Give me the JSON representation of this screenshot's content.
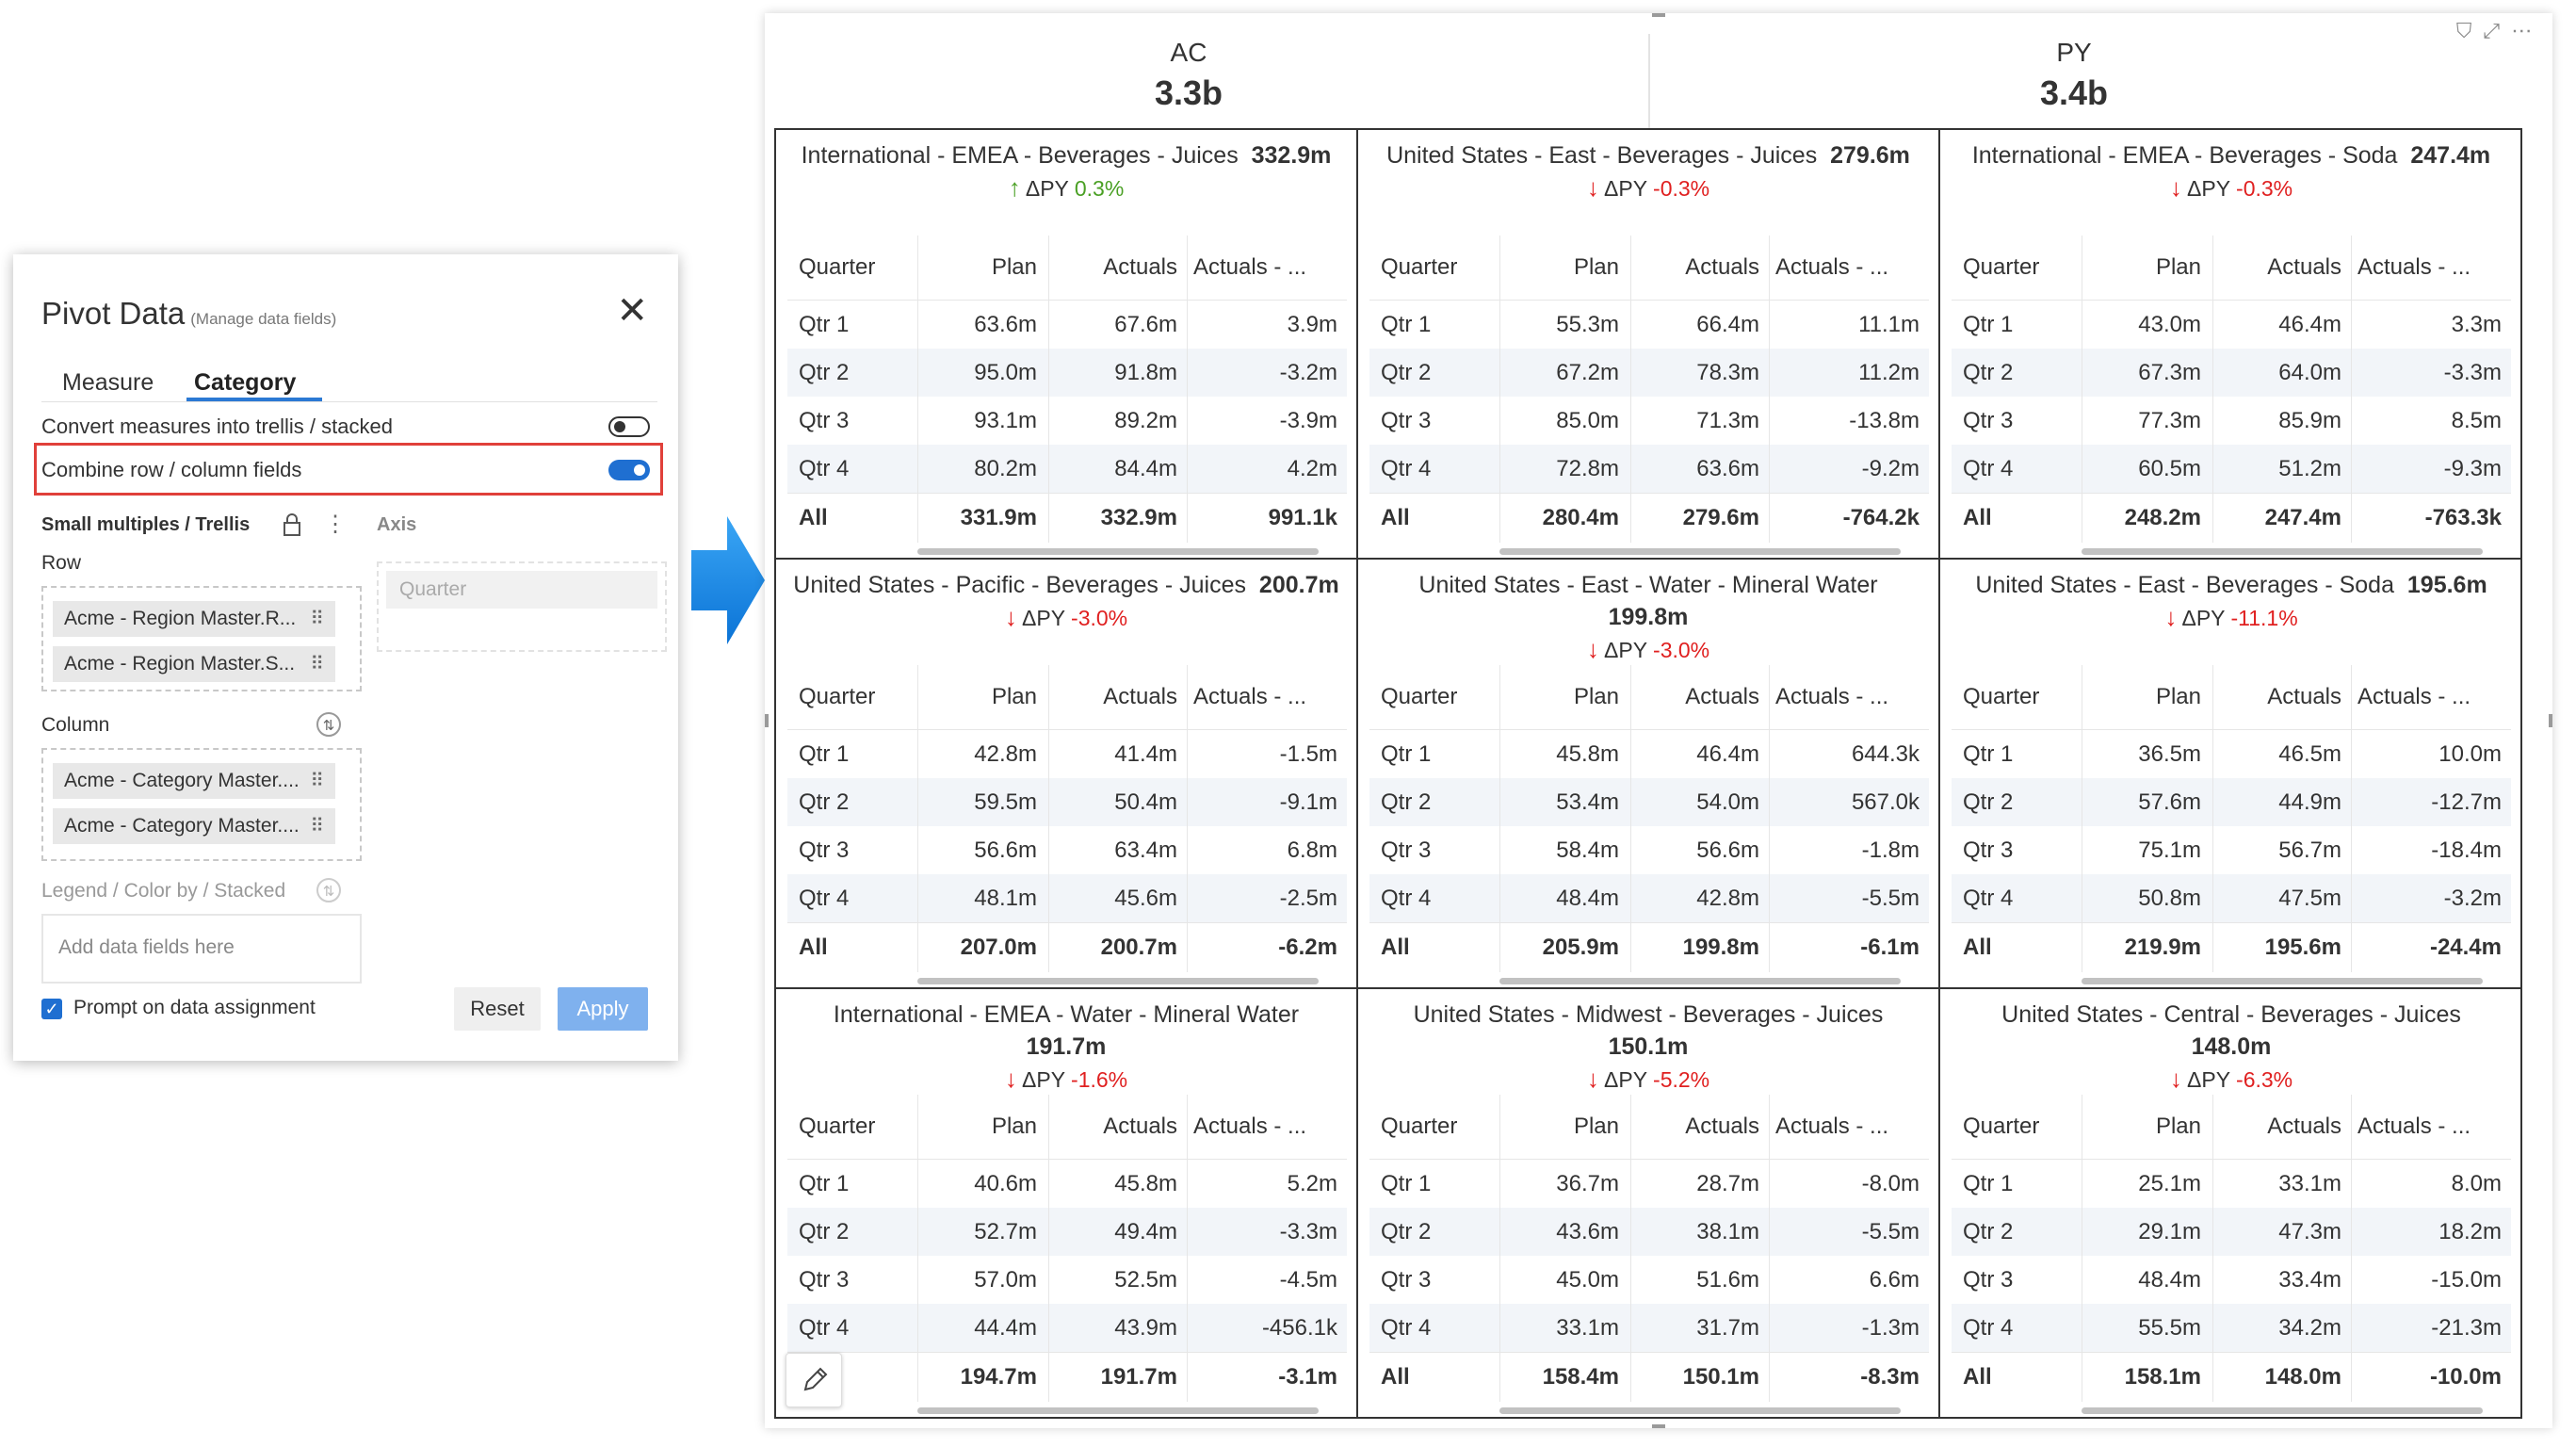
{
  "panel": {
    "title": "Pivot Data",
    "subtitle": "(Manage data fields)",
    "close_icon": "close-icon",
    "tabs": [
      {
        "label": "Measure"
      },
      {
        "label": "Category"
      }
    ],
    "convert_label": "Convert measures into trellis / stacked",
    "convert_on": false,
    "combine_label": "Combine row / column fields",
    "combine_on": true,
    "small_multiples_label": "Small multiples / Trellis",
    "axis_label": "Axis",
    "axis_placeholder": "Quarter",
    "row_label": "Row",
    "row_fields": [
      "Acme - Region Master.R...",
      "Acme - Region Master.S..."
    ],
    "column_label": "Column",
    "column_fields": [
      "Acme - Category Master....",
      "Acme - Category Master...."
    ],
    "legend_label": "Legend / Color by / Stacked",
    "legend_placeholder": "Add data fields here",
    "prompt_label": "Prompt on data assignment",
    "prompt_checked": true,
    "reset_label": "Reset",
    "apply_label": "Apply",
    "accent": "#1f6fd1",
    "highlight": "#e0403a"
  },
  "visual": {
    "kpis": [
      {
        "label": "AC",
        "value": "3.3b"
      },
      {
        "label": "PY",
        "value": "3.4b"
      }
    ],
    "header_icons": [
      "filter-icon",
      "focus-mode-icon",
      "more-options-icon"
    ],
    "column_headers": [
      "Quarter",
      "Plan",
      "Actuals",
      "Actuals - ..."
    ],
    "delta_label": "ΔPY",
    "cells": [
      {
        "name": "International - EMEA - Beverages - Juices",
        "value": "332.9m",
        "delta": "0.3%",
        "dir": "up",
        "rows": [
          [
            "Qtr 1",
            "63.6m",
            "67.6m",
            "3.9m"
          ],
          [
            "Qtr 2",
            "95.0m",
            "91.8m",
            "-3.2m"
          ],
          [
            "Qtr 3",
            "93.1m",
            "89.2m",
            "-3.9m"
          ],
          [
            "Qtr 4",
            "80.2m",
            "84.4m",
            "4.2m"
          ],
          [
            "All",
            "331.9m",
            "332.9m",
            "991.1k"
          ]
        ]
      },
      {
        "name": "United States - East - Beverages - Juices",
        "value": "279.6m",
        "delta": "-0.3%",
        "dir": "down",
        "rows": [
          [
            "Qtr 1",
            "55.3m",
            "66.4m",
            "11.1m"
          ],
          [
            "Qtr 2",
            "67.2m",
            "78.3m",
            "11.2m"
          ],
          [
            "Qtr 3",
            "85.0m",
            "71.3m",
            "-13.8m"
          ],
          [
            "Qtr 4",
            "72.8m",
            "63.6m",
            "-9.2m"
          ],
          [
            "All",
            "280.4m",
            "279.6m",
            "-764.2k"
          ]
        ]
      },
      {
        "name": "International - EMEA - Beverages - Soda",
        "value": "247.4m",
        "delta": "-0.3%",
        "dir": "down",
        "rows": [
          [
            "Qtr 1",
            "43.0m",
            "46.4m",
            "3.3m"
          ],
          [
            "Qtr 2",
            "67.3m",
            "64.0m",
            "-3.3m"
          ],
          [
            "Qtr 3",
            "77.3m",
            "85.9m",
            "8.5m"
          ],
          [
            "Qtr 4",
            "60.5m",
            "51.2m",
            "-9.3m"
          ],
          [
            "All",
            "248.2m",
            "247.4m",
            "-763.3k"
          ]
        ]
      },
      {
        "name": "United States - Pacific - Beverages - Juices",
        "value": "200.7m",
        "delta": "-3.0%",
        "dir": "down",
        "rows": [
          [
            "Qtr 1",
            "42.8m",
            "41.4m",
            "-1.5m"
          ],
          [
            "Qtr 2",
            "59.5m",
            "50.4m",
            "-9.1m"
          ],
          [
            "Qtr 3",
            "56.6m",
            "63.4m",
            "6.8m"
          ],
          [
            "Qtr 4",
            "48.1m",
            "45.6m",
            "-2.5m"
          ],
          [
            "All",
            "207.0m",
            "200.7m",
            "-6.2m"
          ]
        ]
      },
      {
        "name": "United States - East - Water - Mineral Water",
        "value": "199.8m",
        "delta": "-3.0%",
        "dir": "down",
        "wrap": true,
        "rows": [
          [
            "Qtr 1",
            "45.8m",
            "46.4m",
            "644.3k"
          ],
          [
            "Qtr 2",
            "53.4m",
            "54.0m",
            "567.0k"
          ],
          [
            "Qtr 3",
            "58.4m",
            "56.6m",
            "-1.8m"
          ],
          [
            "Qtr 4",
            "48.4m",
            "42.8m",
            "-5.5m"
          ],
          [
            "All",
            "205.9m",
            "199.8m",
            "-6.1m"
          ]
        ]
      },
      {
        "name": "United States - East - Beverages - Soda",
        "value": "195.6m",
        "delta": "-11.1%",
        "dir": "down",
        "rows": [
          [
            "Qtr 1",
            "36.5m",
            "46.5m",
            "10.0m"
          ],
          [
            "Qtr 2",
            "57.6m",
            "44.9m",
            "-12.7m"
          ],
          [
            "Qtr 3",
            "75.1m",
            "56.7m",
            "-18.4m"
          ],
          [
            "Qtr 4",
            "50.8m",
            "47.5m",
            "-3.2m"
          ],
          [
            "All",
            "219.9m",
            "195.6m",
            "-24.4m"
          ]
        ]
      },
      {
        "name": "International - EMEA - Water - Mineral Water",
        "value": "191.7m",
        "delta": "-1.6%",
        "dir": "down",
        "wrap": true,
        "rows": [
          [
            "Qtr 1",
            "40.6m",
            "45.8m",
            "5.2m"
          ],
          [
            "Qtr 2",
            "52.7m",
            "49.4m",
            "-3.3m"
          ],
          [
            "Qtr 3",
            "57.0m",
            "52.5m",
            "-4.5m"
          ],
          [
            "Qtr 4",
            "44.4m",
            "43.9m",
            "-456.1k"
          ],
          [
            "",
            "194.7m",
            "191.7m",
            "-3.1m"
          ]
        ]
      },
      {
        "name": "United States - Midwest - Beverages - Juices",
        "value": "150.1m",
        "delta": "-5.2%",
        "dir": "down",
        "wrap": true,
        "rows": [
          [
            "Qtr 1",
            "36.7m",
            "28.7m",
            "-8.0m"
          ],
          [
            "Qtr 2",
            "43.6m",
            "38.1m",
            "-5.5m"
          ],
          [
            "Qtr 3",
            "45.0m",
            "51.6m",
            "6.6m"
          ],
          [
            "Qtr 4",
            "33.1m",
            "31.7m",
            "-1.3m"
          ],
          [
            "All",
            "158.4m",
            "150.1m",
            "-8.3m"
          ]
        ]
      },
      {
        "name": "United States - Central - Beverages - Juices",
        "value": "148.0m",
        "delta": "-6.3%",
        "dir": "down",
        "wrap": true,
        "rows": [
          [
            "Qtr 1",
            "25.1m",
            "33.1m",
            "8.0m"
          ],
          [
            "Qtr 2",
            "29.1m",
            "47.3m",
            "18.2m"
          ],
          [
            "Qtr 3",
            "48.4m",
            "33.4m",
            "-15.0m"
          ],
          [
            "Qtr 4",
            "55.5m",
            "34.2m",
            "-21.3m"
          ],
          [
            "All",
            "158.1m",
            "148.0m",
            "-10.0m"
          ]
        ]
      }
    ]
  }
}
